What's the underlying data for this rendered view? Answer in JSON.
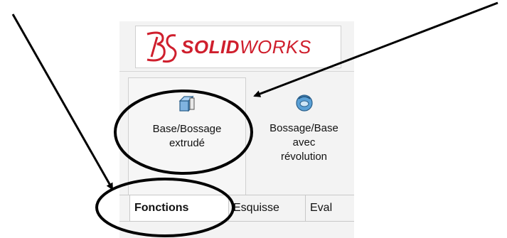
{
  "app": {
    "logo_text_strong": "SOLID",
    "logo_text_light": "WORKS",
    "logo_color": "#cf1f2d"
  },
  "ribbon": {
    "commands": [
      {
        "label_line1": "Base/Bossage",
        "label_line2": "extrudé",
        "label_line3": "",
        "icon": "extruded-boss-icon"
      },
      {
        "label_line1": "Bossage/Base",
        "label_line2": "avec",
        "label_line3": "révolution",
        "icon": "revolved-boss-icon"
      }
    ]
  },
  "tabs": [
    {
      "label": "Fonctions",
      "active": true
    },
    {
      "label": "Esquisse",
      "active": false
    },
    {
      "label": "Eval",
      "active": false
    }
  ],
  "annotations": {
    "stroke_color": "#000000"
  }
}
